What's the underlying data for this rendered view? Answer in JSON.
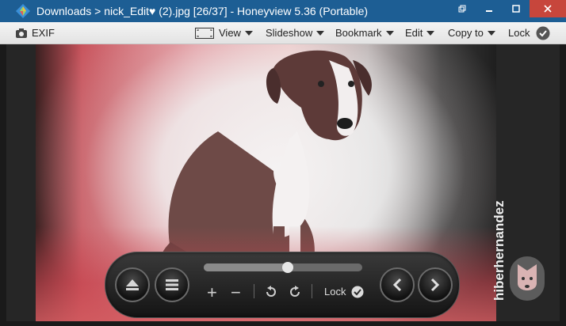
{
  "window": {
    "title": "Downloads > nick_Edit♥ (2).jpg [26/37] - Honeyview 5.36 (Portable)"
  },
  "toolbar": {
    "exif_label": "EXIF",
    "view_label": "View",
    "slideshow_label": "Slideshow",
    "bookmark_label": "Bookmark",
    "edit_label": "Edit",
    "copy_to_label": "Copy to",
    "lock_label": "Lock"
  },
  "controls": {
    "lock_label": "Lock",
    "slider_position": 0.53
  },
  "watermark": {
    "text": "hiberhernandez"
  },
  "icons": {
    "app": "honeyview-diamond-icon",
    "camera": "camera-icon",
    "view": "fit-screen-icon",
    "lock": "check-circle-icon",
    "eject": "eject-icon",
    "menu": "menu-icon",
    "zoom_in": "plus-icon",
    "zoom_out": "minus-icon",
    "rotate_left": "rotate-left-icon",
    "rotate_right": "rotate-right-icon",
    "prev": "chevron-left-icon",
    "next": "chevron-right-icon"
  },
  "colors": {
    "titlebar": "#1d5e94",
    "close_button": "#c7463c"
  }
}
